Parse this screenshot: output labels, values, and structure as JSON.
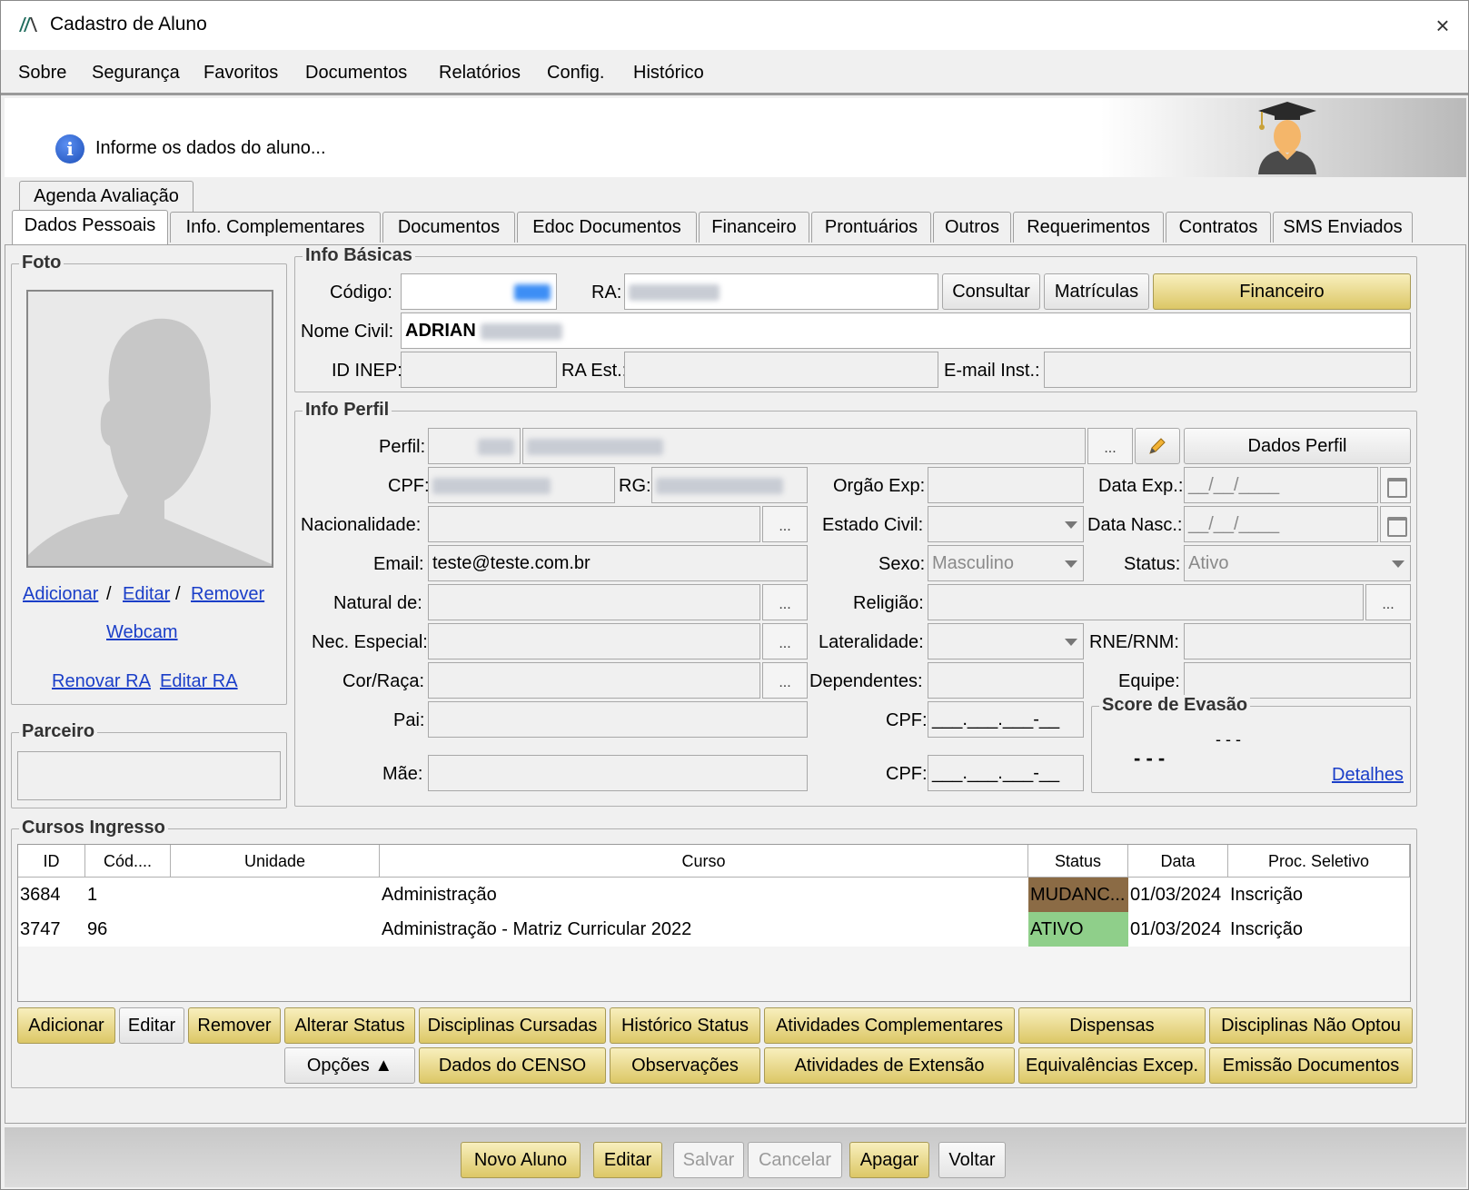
{
  "window": {
    "title": "Cadastro de Aluno",
    "close_icon": "×"
  },
  "menu": [
    "Sobre",
    "Segurança",
    "Favoritos",
    "Documentos",
    "Relatórios",
    "Config.",
    "Histórico"
  ],
  "info": {
    "message": "Informe os dados do aluno..."
  },
  "tabs_row1": [
    "Agenda Avaliação"
  ],
  "tabs_row2": [
    "Dados Pessoais",
    "Info. Complementares",
    "Documentos",
    "Edoc Documentos",
    "Financeiro",
    "Prontuários",
    "Outros",
    "Requerimentos",
    "Contratos",
    "SMS Enviados"
  ],
  "foto": {
    "title": "Foto",
    "add": "Adicionar",
    "edit": "Editar",
    "remove": "Remover",
    "sep": "/",
    "webcam": "Webcam",
    "renew_ra": "Renovar RA",
    "edit_ra": "Editar RA"
  },
  "parceiro": {
    "title": "Parceiro"
  },
  "info_basicas": {
    "title": "Info Básicas",
    "codigo_label": "Código:",
    "ra_label": "RA:",
    "consultar": "Consultar",
    "matriculas": "Matrículas",
    "financeiro": "Financeiro",
    "nome_label": "Nome Civil:",
    "nome_value": "ADRIAN",
    "id_inep_label": "ID INEP:",
    "ra_est_label": "RA Est.:",
    "email_inst_label": "E-mail Inst.:"
  },
  "info_perfil": {
    "title": "Info Perfil",
    "perfil_label": "Perfil:",
    "dots": "...",
    "dados_perfil": "Dados Perfil",
    "cpf_label": "CPF:",
    "rg_label": "RG:",
    "orgao_label": "Orgão Exp:",
    "data_exp_label": "Data Exp.:",
    "date_mask": "__/__/____",
    "nacionalidade_label": "Nacionalidade:",
    "estado_civil_label": "Estado Civil:",
    "data_nasc_label": "Data Nasc.:",
    "email_label": "Email:",
    "email_value": "teste@teste.com.br",
    "sexo_label": "Sexo:",
    "sexo_value": "Masculino",
    "status_label": "Status:",
    "status_value": "Ativo",
    "natural_label": "Natural de:",
    "religiao_label": "Religião:",
    "nec_label": "Nec. Especial:",
    "lateralidade_label": "Lateralidade:",
    "rne_label": "RNE/RNM:",
    "cor_label": "Cor/Raça:",
    "dependentes_label": "Dependentes:",
    "equipe_label": "Equipe:",
    "pai_label": "Pai:",
    "mae_label": "Mãe:",
    "cpf_mask": "___.___.___-__"
  },
  "score": {
    "title": "Score de Evasão",
    "top": "- - -",
    "value": "- - -",
    "details": "Detalhes"
  },
  "cursos": {
    "title": "Cursos Ingresso",
    "headers": [
      "ID",
      "Cód....",
      "Unidade",
      "Curso",
      "Status",
      "Data",
      "Proc. Seletivo"
    ],
    "rows": [
      {
        "id": "3684",
        "cod": "1",
        "unidade": "",
        "curso": "Administração",
        "status": "MUDANC...",
        "data": "01/03/2024",
        "proc": "Inscrição"
      },
      {
        "id": "3747",
        "cod": "96",
        "unidade": "",
        "curso": "Administração - Matriz Curricular 2022",
        "status": "ATIVO",
        "data": "01/03/2024",
        "proc": "Inscrição"
      }
    ],
    "status_colors": {
      "mudanc": "#8b6b45",
      "ativo": "#8fcf8a"
    }
  },
  "actions_row1": [
    "Adicionar",
    "Editar",
    "Remover",
    "Alterar Status",
    "Disciplinas Cursadas",
    "Histórico Status",
    "Atividades Complementares",
    "Dispensas",
    "Disciplinas Não Optou"
  ],
  "actions_row2": [
    "Opções ▲",
    "Dados do CENSO",
    "Observações",
    "Atividades de Extensão",
    "Equivalências Excep.",
    "Emissão Documentos"
  ],
  "bottom": [
    "Novo Aluno",
    "Editar",
    "Salvar",
    "Cancelar",
    "Apagar",
    "Voltar"
  ],
  "colors": {
    "gold_button": "#e8d98a",
    "link": "#1a3ec8"
  }
}
